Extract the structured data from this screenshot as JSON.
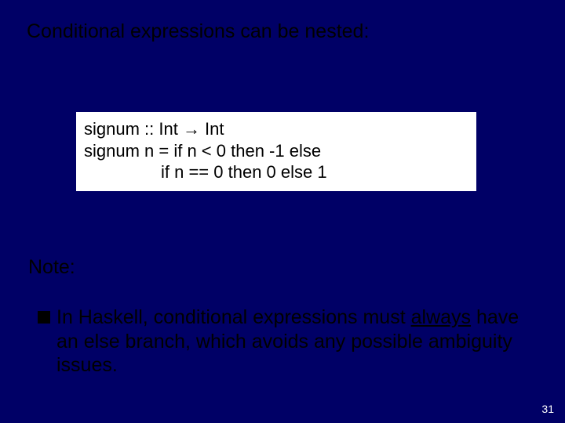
{
  "heading": "Conditional expressions can be nested:",
  "code": {
    "line1": "signum  :: Int → Int",
    "line2": "signum n = if n < 0 then -1 else",
    "line3": "if n == 0 then 0 else 1"
  },
  "note_label": "Note:",
  "bullet": {
    "pre": "In Haskell, conditional expressions must ",
    "underlined": "always",
    "post": " have an else branch, which avoids any possible ambiguity issues."
  },
  "page_number": "31"
}
